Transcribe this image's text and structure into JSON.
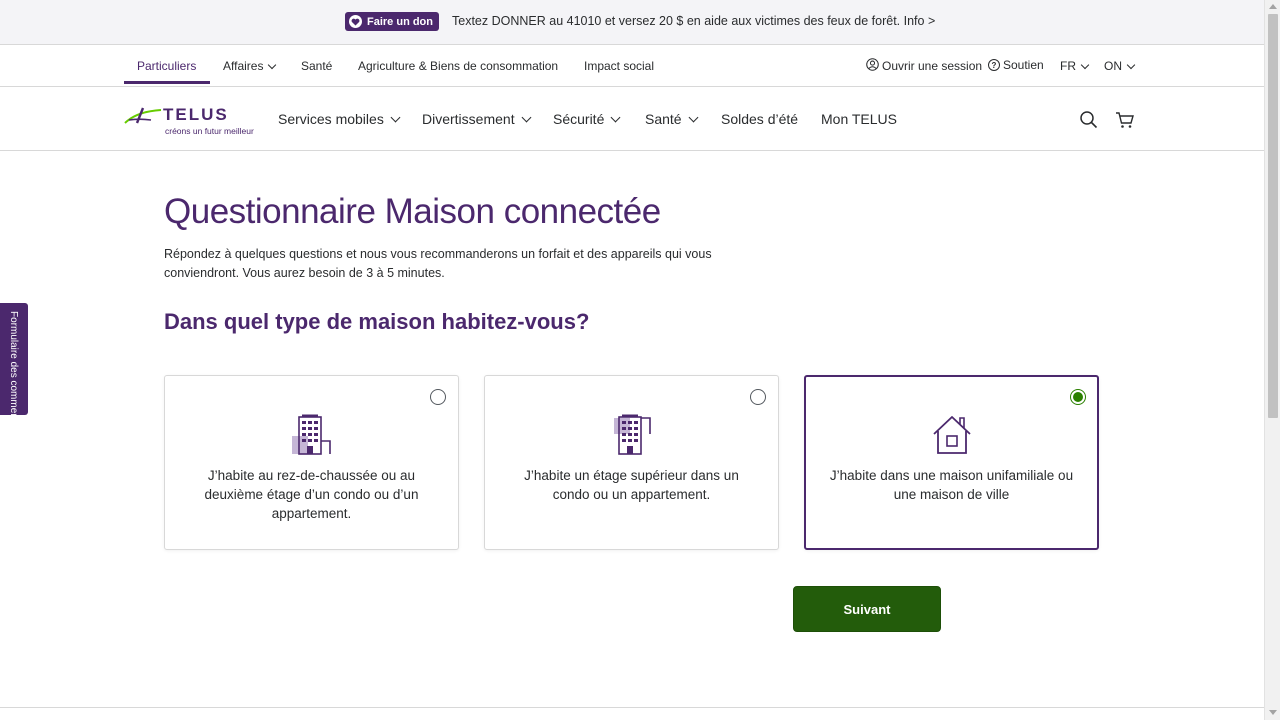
{
  "promo": {
    "button_label": "Faire un don",
    "message": "Textez DONNER au 41010 et versez 20 $ en aide aux victimes des feux de forêt. Info >"
  },
  "utility_nav": {
    "segments": [
      {
        "label": "Particuliers",
        "active": true
      },
      {
        "label": "Affaires",
        "dropdown": true
      },
      {
        "label": "Santé"
      },
      {
        "label": "Agriculture & Biens de consommation"
      },
      {
        "label": "Impact social"
      }
    ],
    "sign_in": "Ouvrir une session",
    "support": "Soutien",
    "language": "FR",
    "province": "ON"
  },
  "main_nav": {
    "logo_word": "TELUS",
    "logo_tagline": "créons un futur meilleur",
    "items": [
      {
        "label": "Services mobiles",
        "dropdown": true
      },
      {
        "label": "Divertissement",
        "dropdown": true
      },
      {
        "label": "Sécurité",
        "dropdown": true
      },
      {
        "label": "Santé",
        "dropdown": true
      },
      {
        "label": "Soldes d’été"
      },
      {
        "label": "Mon TELUS"
      }
    ]
  },
  "feedback_tab": "Formulaire des comment",
  "page": {
    "title": "Questionnaire Maison connectée",
    "intro": "Répondez à quelques questions et nous vous recommanderons un forfait et des appareils qui vous conviendront. Vous aurez besoin de 3 à 5 minutes.",
    "question": "Dans quel type de maison habitez-vous?",
    "options": [
      {
        "label": "J’habite au rez-de-chaussée ou au deuxième étage d’un condo ou d’un appartement.",
        "icon": "low-rise-building-icon",
        "selected": false
      },
      {
        "label": "J’habite un étage supérieur dans un condo ou un appartement.",
        "icon": "high-rise-building-icon",
        "selected": false
      },
      {
        "label": "J’habite dans une maison unifamiliale ou une maison de ville",
        "icon": "house-icon",
        "selected": true
      }
    ],
    "next_button": "Suivant"
  },
  "colors": {
    "brand_purple": "#4b286d",
    "accent_green": "#2b8000",
    "button_green": "#235c0b"
  }
}
